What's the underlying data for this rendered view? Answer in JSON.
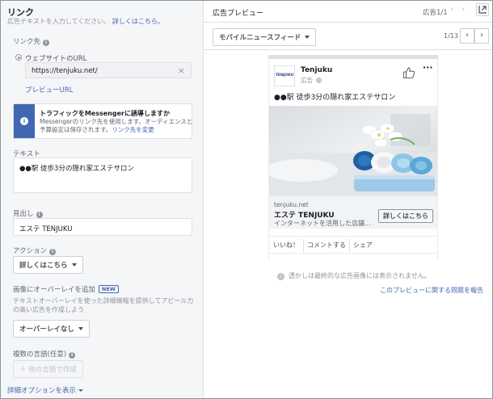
{
  "left": {
    "title": "リンク",
    "subtitle": "広告テキストを入力してください。",
    "learn_more": "詳しくはこちら。",
    "destination": {
      "label": "リンク先",
      "option_label": "ウェブサイトのURL",
      "url_value": "https://tenjuku.net/",
      "preview_url": "プレビューURL"
    },
    "messenger_notice": {
      "title": "トラフィックをMessengerに誘導しますか",
      "body": "Messengerのリンク先を使用します。オーディエンスと予算設定は保存されます。",
      "link": "リンク先を変更"
    },
    "text": {
      "label": "テキスト",
      "value": "●●駅 徒歩3分の隠れ家エステサロン"
    },
    "headline": {
      "label": "見出し",
      "value": "エステ TENJUKU"
    },
    "action": {
      "label": "アクション",
      "value": "詳しくはこちら"
    },
    "overlay": {
      "label": "画像にオーバーレイを追加",
      "badge": "NEW",
      "description": "テキストオーバーレイを使った詳細情報を提供してアピール力の高い広告を作成しよう",
      "button": "オーバーレイなし"
    },
    "languages": {
      "label": "複数の言語(任意)",
      "button": "他の言語で作成"
    },
    "advanced": "詳細オプションを表示"
  },
  "preview": {
    "title": "広告プレビュー",
    "ad_count": "広告1/1",
    "placement": "モバイルニュースフィード",
    "page_indicator": "1/13",
    "post": {
      "page_name": "Tenjuku",
      "logo_text": "TENJUKU",
      "sponsored": "広告",
      "text": "●●駅 徒歩3分の隠れ家エステサロン",
      "domain": "tenjuku.net",
      "headline": "エステ TENJUKU",
      "description": "インターネットを活用した店舗...",
      "cta": "詳しくはこちら",
      "actions": [
        "いいね！",
        "コメントする",
        "シェア"
      ]
    },
    "disclaimer": "透かしは最終的な広告画像には表示されません。",
    "report_link": "このプレビューに関する問題を報告"
  },
  "icons": [
    "info-icon",
    "clear-icon",
    "messenger-info-icon",
    "caret-down-icon",
    "external-link-icon",
    "chevron-left-icon",
    "chevron-right-icon",
    "globe-icon",
    "thumbs-up-icon",
    "more-icon",
    "plus-icon"
  ],
  "colors": {
    "accent": "#4267b2",
    "panel_bg": "#f5f6f7",
    "border": "#dddfe2",
    "muted_text": "#90949c"
  }
}
